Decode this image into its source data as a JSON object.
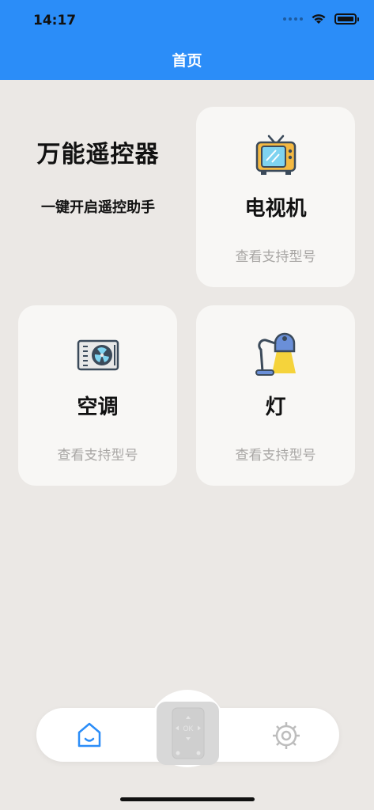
{
  "status_bar": {
    "time": "14:17"
  },
  "header": {
    "title": "首页"
  },
  "intro": {
    "title": "万能遥控器",
    "subtitle": "一键开启遥控助手"
  },
  "cards": [
    {
      "name": "电视机",
      "sub": "查看支持型号",
      "icon": "tv-icon"
    },
    {
      "name": "空调",
      "sub": "查看支持型号",
      "icon": "air-conditioner-icon"
    },
    {
      "name": "灯",
      "sub": "查看支持型号",
      "icon": "lamp-icon"
    }
  ],
  "tabbar": {
    "items": [
      "home-icon",
      "remote-icon",
      "settings-icon"
    ],
    "center_label": "OK",
    "active_color": "#2b8df8",
    "inactive_color": "#bdbdbd"
  },
  "colors": {
    "header_bg": "#2b8df8",
    "page_bg": "#ebe8e5",
    "card_bg": "#f8f7f5"
  }
}
